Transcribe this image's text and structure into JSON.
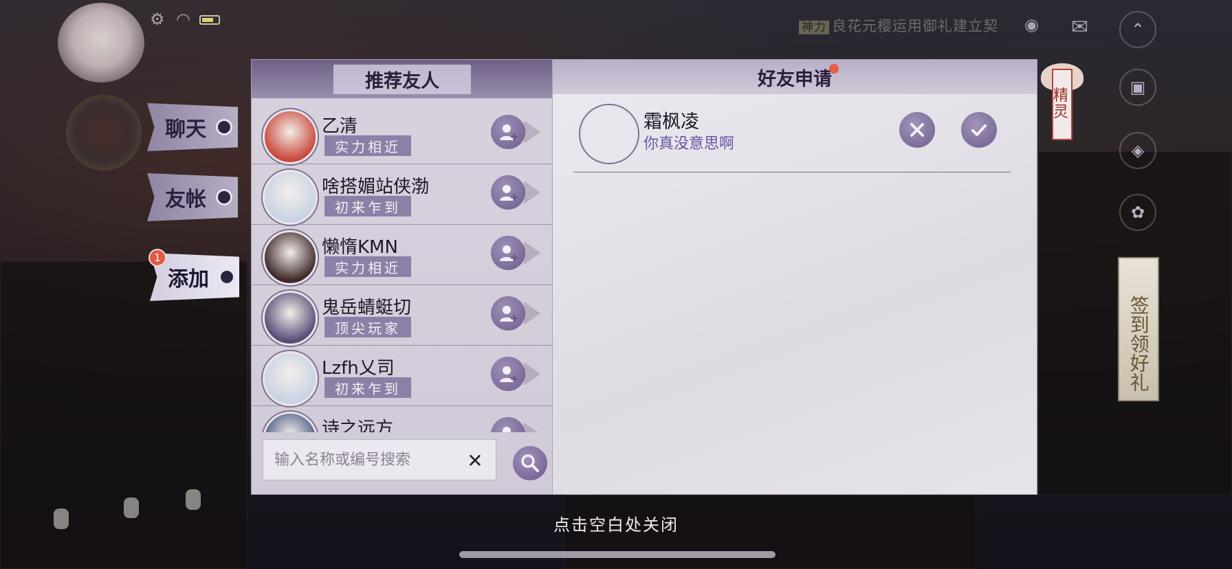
{
  "top_bar": {
    "marquee_tag": "神力",
    "marquee_text": "良花元樱运用御礼建立契"
  },
  "side_tabs": [
    {
      "label": "聊天",
      "active": false
    },
    {
      "label": "友帐",
      "active": false
    },
    {
      "label": "添加",
      "active": true,
      "badge": "1"
    }
  ],
  "recommend": {
    "title": "推荐友人",
    "items": [
      {
        "name": "乙清",
        "tag": "实力相近",
        "avatar_color": "#c94a3c"
      },
      {
        "name": "啥搭媚站侠渤",
        "tag": "初来乍到",
        "avatar_color": "#c9d3e4"
      },
      {
        "name": "懒惰KMN",
        "tag": "实力相近",
        "avatar_color": "#3f2a2a"
      },
      {
        "name": "鬼岳蜻蜓切",
        "tag": "顶尖玩家",
        "avatar_color": "#5a4e78"
      },
      {
        "name": "Lzfh乂司",
        "tag": "初来乍到",
        "avatar_color": "#c9d3e4"
      },
      {
        "name": "诗之远方",
        "tag": "",
        "avatar_color": "#4a5a86"
      }
    ],
    "search_placeholder": "输入名称或编号搜索"
  },
  "requests": {
    "title": "好友申请",
    "items": [
      {
        "name": "霜枫凌",
        "message": "你真没意思啊",
        "avatar_color": "#b3473a"
      }
    ]
  },
  "sprite_label": "精灵",
  "banner_label": "签到领好礼",
  "close_hint": "点击空白处关闭",
  "colors": {
    "panel_purple": "#8d80a6",
    "accent_text": "#6a53a2",
    "badge_red": "#e05a47"
  }
}
